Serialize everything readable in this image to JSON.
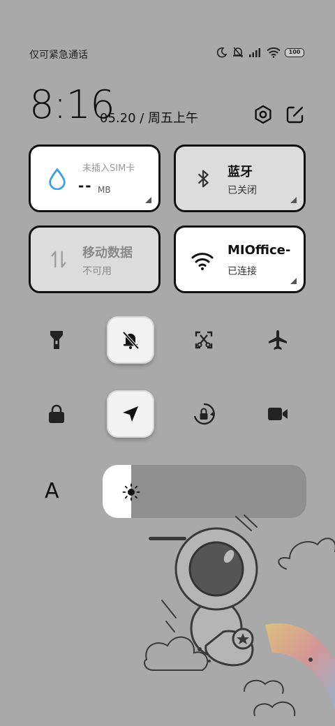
{
  "status_bar": {
    "carrier": "仅可紧急通话",
    "battery": "100",
    "icons": [
      "moon-icon",
      "muted-bell-icon",
      "signal-icon",
      "wifi-icon",
      "battery-icon"
    ]
  },
  "header": {
    "time": "8:16",
    "date": "05.20 / 周五上午",
    "settings_icon": "settings-icon",
    "edit_icon": "edit-icon"
  },
  "tiles": {
    "mobile_data_usage": {
      "label": "未插入SIM卡",
      "value": "--",
      "unit": "MB",
      "icon": "water-drop-icon"
    },
    "bluetooth": {
      "title": "蓝牙",
      "status": "已关闭",
      "icon": "bluetooth-icon"
    },
    "mobile_data": {
      "title": "移动数据",
      "status": "不可用",
      "icon": "data-arrows-icon"
    },
    "wifi": {
      "title": "MIOffice-",
      "status": "已连接",
      "icon": "wifi-icon"
    }
  },
  "toggles": [
    {
      "name": "flashlight",
      "icon": "flashlight-icon",
      "active": false
    },
    {
      "name": "silent",
      "icon": "bell-off-icon",
      "active": true
    },
    {
      "name": "screenshot",
      "icon": "screenshot-icon",
      "active": false
    },
    {
      "name": "airplane-mode",
      "icon": "airplane-icon",
      "active": false
    },
    {
      "name": "lock-screen",
      "icon": "lock-icon",
      "active": false
    },
    {
      "name": "location",
      "icon": "location-arrow-icon",
      "active": true
    },
    {
      "name": "rotation-lock",
      "icon": "rotation-lock-icon",
      "active": false
    },
    {
      "name": "screen-record",
      "icon": "video-camera-icon",
      "active": false
    }
  ],
  "font_size_button": {
    "label": "A"
  },
  "brightness": {
    "level": 0.14,
    "icon": "sun-icon"
  },
  "colors": {
    "background": "#a9a9a9",
    "tile_on": "#ffffff",
    "tile_off": "#dcdcdc",
    "accent_blue": "#3aa0e8"
  }
}
